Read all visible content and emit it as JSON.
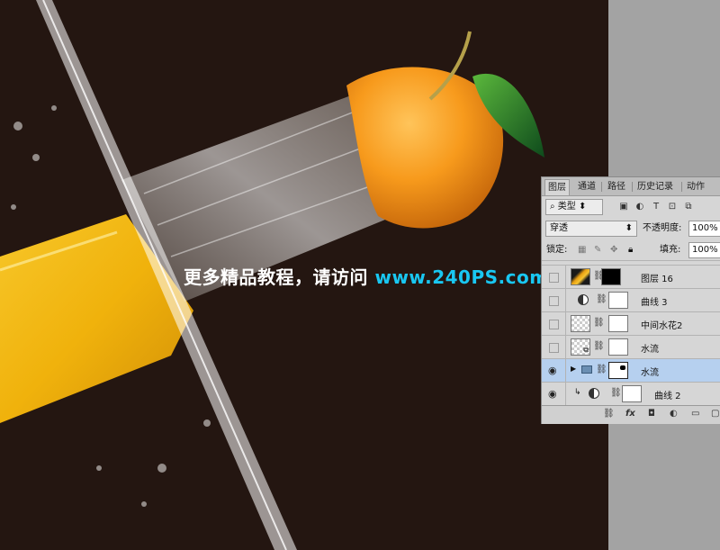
{
  "watermark": {
    "text_cn": "更多精品教程，请访问 ",
    "url": "www.240PS.com"
  },
  "colors": {
    "canvas_bg": "#241611",
    "url_accent": "#19c7f2",
    "selected_row": "#b6d0ef"
  },
  "panel": {
    "tabs": [
      "图层",
      "通道",
      "路径",
      "历史记录",
      "动作"
    ],
    "filter": {
      "kind_label": "类型",
      "icons": [
        "image-icon",
        "adjustment-icon",
        "text-icon",
        "shape-icon",
        "smart-object-icon"
      ],
      "icon_glyphs": [
        "▣",
        "◐",
        "T",
        "⊡",
        "⧉"
      ]
    },
    "blend": {
      "mode": "穿透",
      "opacity_label": "不透明度:",
      "opacity_value": "100%"
    },
    "lock": {
      "label": "锁定:",
      "fill_label": "填充:",
      "fill_value": "100%"
    },
    "layers": [
      {
        "name": "图层 16",
        "visible": false,
        "thumb": "orange",
        "mask": "black"
      },
      {
        "name": "曲线 3",
        "visible": false,
        "thumb": "adjustment",
        "mask": "white"
      },
      {
        "name": "中间水花2",
        "visible": false,
        "thumb": "checker",
        "mask": "white"
      },
      {
        "name": "水流",
        "visible": false,
        "thumb": "checker-smart",
        "mask": "white"
      },
      {
        "name": "水流",
        "visible": true,
        "thumb": "folder",
        "mask": "white-dots",
        "selected": true
      },
      {
        "name": "曲线 2",
        "visible": true,
        "thumb": "adjustment",
        "mask": "white",
        "clipped": true
      }
    ],
    "footer_icons": [
      "link-icon",
      "fx-icon",
      "mask-icon",
      "adjustment-icon",
      "folder-icon",
      "new-layer-icon"
    ],
    "footer_glyphs": [
      "⛓",
      "fx",
      "◘",
      "◐",
      "▭",
      "▢"
    ]
  }
}
